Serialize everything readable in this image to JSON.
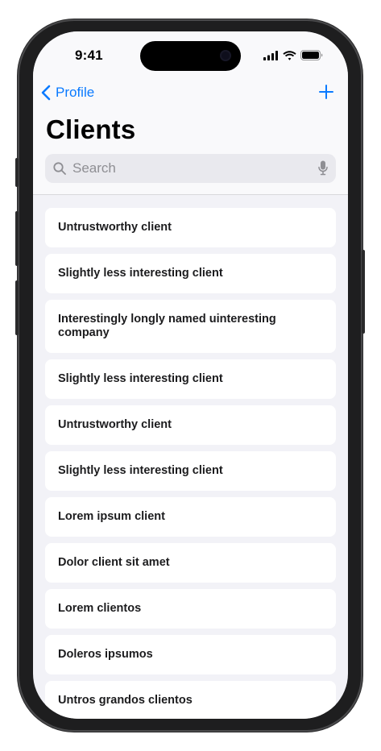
{
  "status_bar": {
    "time": "9:41"
  },
  "nav": {
    "back_label": "Profile",
    "title": "Clients",
    "add_icon": "plus-icon",
    "back_icon": "chevron-left-icon"
  },
  "search": {
    "placeholder": "Search",
    "value": ""
  },
  "clients": [
    {
      "name": "Untrustworthy client"
    },
    {
      "name": "Slightly less interesting client"
    },
    {
      "name": "Interestingly longly named uinteresting company"
    },
    {
      "name": "Slightly less interesting client"
    },
    {
      "name": "Untrustworthy client"
    },
    {
      "name": "Slightly less interesting client"
    },
    {
      "name": "Lorem ipsum client"
    },
    {
      "name": "Dolor client sit amet"
    },
    {
      "name": "Lorem clientos"
    },
    {
      "name": "Doleros ipsumos"
    },
    {
      "name": "Untros grandos clientos"
    }
  ],
  "colors": {
    "accent": "#0a7aff",
    "background": "#f2f2f7",
    "card": "#ffffff"
  }
}
